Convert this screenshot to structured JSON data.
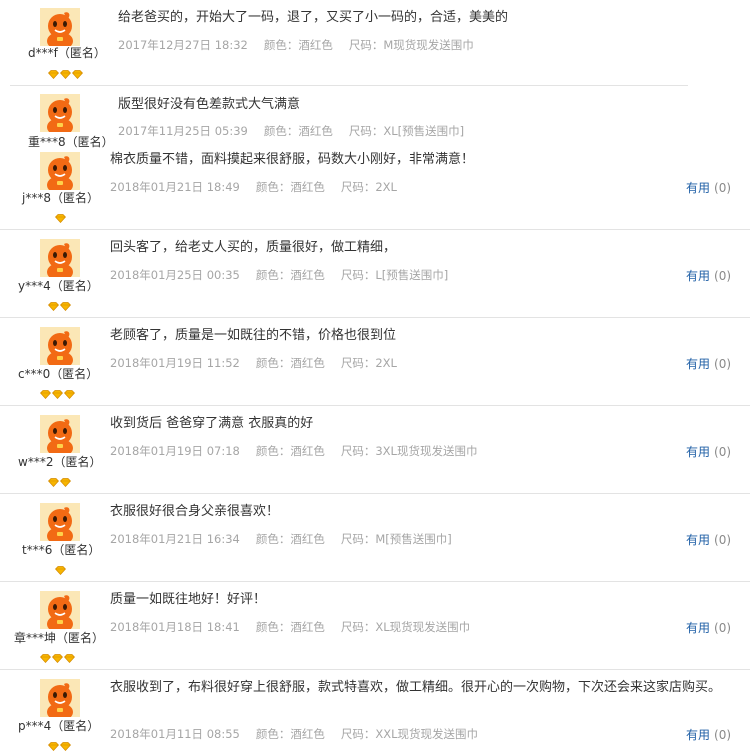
{
  "useful_label": "有用",
  "reviews": [
    {
      "user": "d***f（匿名）",
      "text": "给老爸买的，开始大了一码，退了，又买了小一码的，合适，美美的",
      "date": "2017年12月27日 18:32",
      "color": "颜色：酒红色",
      "size": "尺码：M现货现发送围巾",
      "badges": 3,
      "useful_count": ""
    },
    {
      "user": "重***8（匿名）",
      "text": "版型很好没有色差款式大气满意",
      "date": "2017年11月25日 05:39",
      "color": "颜色：酒红色",
      "size": "尺码：XL[预售送围巾]",
      "badges": 0,
      "useful_count": ""
    },
    {
      "user": "j***8（匿名）",
      "text": "棉衣质量不错，面料摸起来很舒服，码数大小刚好，非常满意！",
      "date": "2018年01月21日 18:49",
      "color": "颜色：酒红色",
      "size": "尺码：2XL",
      "badges": 1,
      "useful_count": "(0)"
    },
    {
      "user": "y***4（匿名）",
      "text": "回头客了，给老丈人买的，质量很好，做工精细，",
      "date": "2018年01月25日 00:35",
      "color": "颜色：酒红色",
      "size": "尺码：L[预售送围巾]",
      "badges": 2,
      "useful_count": "(0)"
    },
    {
      "user": "c***0（匿名）",
      "text": "老顾客了，质量是一如既往的不错，价格也很到位",
      "date": "2018年01月19日 11:52",
      "color": "颜色：酒红色",
      "size": "尺码：2XL",
      "badges": 3,
      "useful_count": "(0)"
    },
    {
      "user": "w***2（匿名）",
      "text": "收到货后 爸爸穿了满意 衣服真的好",
      "date": "2018年01月19日 07:18",
      "color": "颜色：酒红色",
      "size": "尺码：3XL现货现发送围巾",
      "badges": 2,
      "useful_count": "(0)"
    },
    {
      "user": "t***6（匿名）",
      "text": "衣服很好很合身父亲很喜欢！",
      "date": "2018年01月21日 16:34",
      "color": "颜色：酒红色",
      "size": "尺码：M[预售送围巾]",
      "badges": 1,
      "useful_count": "(0)"
    },
    {
      "user": "章***坤（匿名）",
      "text": "质量一如既往地好！好评！",
      "date": "2018年01月18日 18:41",
      "color": "颜色：酒红色",
      "size": "尺码：XL现货现发送围巾",
      "badges": 3,
      "useful_count": "(0)"
    },
    {
      "user": "p***4（匿名）",
      "text": "衣服收到了，布料很好穿上很舒服，款式特喜欢，做工精细。很开心的一次购物，下次还会来这家店购买。",
      "date": "2018年01月11日 08:55",
      "color": "颜色：酒红色",
      "size": "尺码：XXL现货现发送围巾",
      "badges": 2,
      "useful_count": "(0)"
    }
  ]
}
